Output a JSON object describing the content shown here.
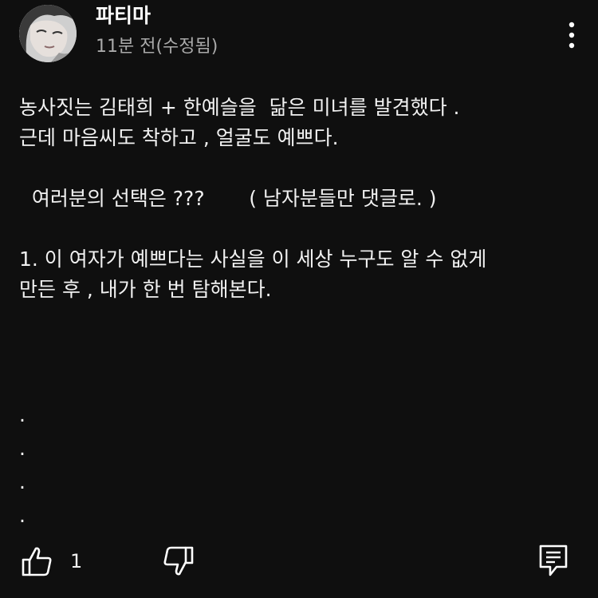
{
  "comment": {
    "author": "파티마",
    "timestamp": "11분 전(수정됨)",
    "lines": [
      "농사짓는 김태희 + 한예슬을  닮은 미녀를 발견했다 .",
      "근데 마음씨도 착하고 , 얼굴도 예쁘다.",
      "",
      "  여러분의 선택은 ???       ( 남자분들만 댓글로. )",
      "",
      "1. 이 여자가 예쁘다는 사실을 이 세상 누구도 알 수 없게",
      "만든 후 , 내가 한 번 탐해본다."
    ],
    "dots": [
      ".",
      ".",
      ".",
      "."
    ]
  },
  "actions": {
    "like_count": "1"
  },
  "icons": {
    "more": "more-vertical-icon",
    "like": "thumbs-up-icon",
    "dislike": "thumbs-down-icon",
    "reply": "comment-reply-icon"
  },
  "colors": {
    "background": "#0f0f0f",
    "text": "#f1f1f1",
    "secondary_text": "#aaaaaa"
  }
}
